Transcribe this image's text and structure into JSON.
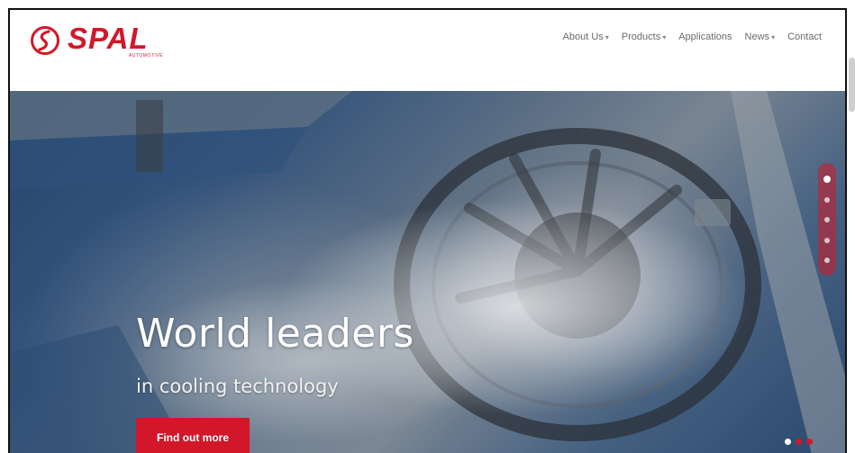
{
  "brand": {
    "name": "SPAL",
    "sub": "AUTOMOTIVE",
    "color": "#d3172a"
  },
  "nav": {
    "items": [
      {
        "label": "About Us",
        "dropdown": true
      },
      {
        "label": "Products",
        "dropdown": true
      },
      {
        "label": "Applications",
        "dropdown": false
      },
      {
        "label": "News",
        "dropdown": true
      },
      {
        "label": "Contact",
        "dropdown": false
      }
    ]
  },
  "hero": {
    "title": "World leaders",
    "subtitle": "in cooling technology",
    "cta_label": "Find out more"
  },
  "icons": {
    "logo": "spal-logo-icon",
    "caret": "chevron-down-icon"
  }
}
